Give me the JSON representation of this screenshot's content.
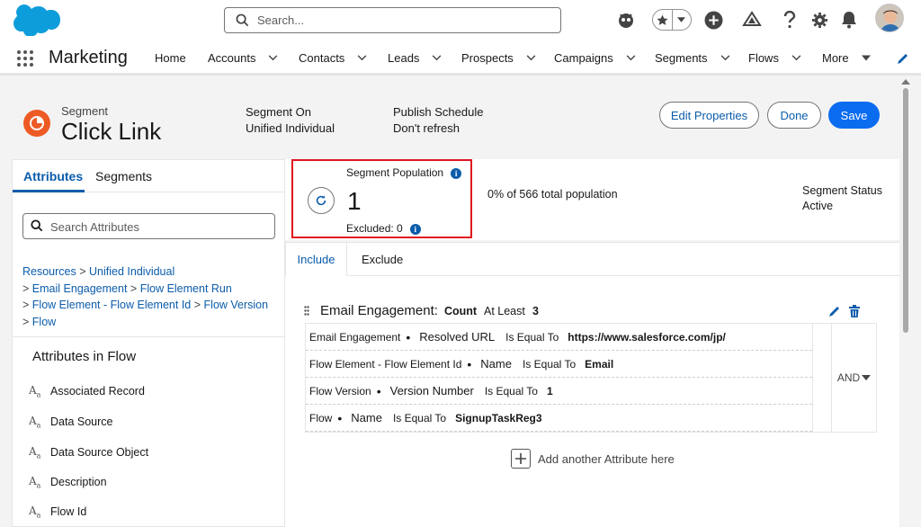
{
  "header": {
    "search_placeholder": "Search..."
  },
  "nav": {
    "app_name": "Marketing",
    "items": [
      {
        "label": "Home"
      },
      {
        "label": "Accounts"
      },
      {
        "label": "Contacts"
      },
      {
        "label": "Leads"
      },
      {
        "label": "Prospects"
      },
      {
        "label": "Campaigns"
      },
      {
        "label": "Segments"
      },
      {
        "label": "Flows"
      },
      {
        "label": "More"
      }
    ]
  },
  "page_header": {
    "object_type": "Segment",
    "title": "Click Link",
    "segment_on_label": "Segment On",
    "segment_on_value": "Unified Individual",
    "publish_label": "Publish Schedule",
    "publish_value": "Don't refresh",
    "buttons": {
      "edit": "Edit Properties",
      "done": "Done",
      "save": "Save"
    }
  },
  "left_panel": {
    "tabs": [
      "Attributes",
      "Segments"
    ],
    "search_placeholder": "Search Attributes",
    "breadcrumb": [
      "Resources",
      "Unified Individual",
      "Email Engagement",
      "Flow Element Run",
      "Flow Element - Flow Element Id",
      "Flow Version",
      "Flow"
    ],
    "section_title": "Attributes in Flow",
    "attributes": [
      "Associated Record",
      "Data Source",
      "Data Source Object",
      "Description",
      "Flow Id"
    ]
  },
  "population": {
    "label": "Segment Population",
    "value": "1",
    "excluded": "Excluded: 0",
    "percent_text": "0% of 566 total population",
    "status_label": "Segment Status",
    "status_value": "Active"
  },
  "rules": {
    "tabs": {
      "include": "Include",
      "exclude": "Exclude"
    },
    "group": {
      "title": "Email Engagement:",
      "agg": "Count",
      "op": "At Least",
      "num": "3"
    },
    "rows": [
      {
        "object": "Email Engagement",
        "field": "Resolved URL",
        "op": "Is Equal To",
        "value": "https://www.salesforce.com/jp/"
      },
      {
        "object": "Flow Element - Flow Element Id",
        "field": "Name",
        "op": "Is Equal To",
        "value": "Email"
      },
      {
        "object": "Flow Version",
        "field": "Version Number",
        "op": "Is Equal To",
        "value": "1"
      },
      {
        "object": "Flow",
        "field": "Name",
        "op": "Is Equal To",
        "value": "SignupTaskReg3"
      }
    ],
    "bullet": "•",
    "logic": "AND",
    "add_label": "Add another Attribute here"
  },
  "colors": {
    "brand": "#0b6cf0",
    "link": "#0b5cab",
    "highlight": "#e0141e",
    "segment_icon": "#ee5a24"
  }
}
